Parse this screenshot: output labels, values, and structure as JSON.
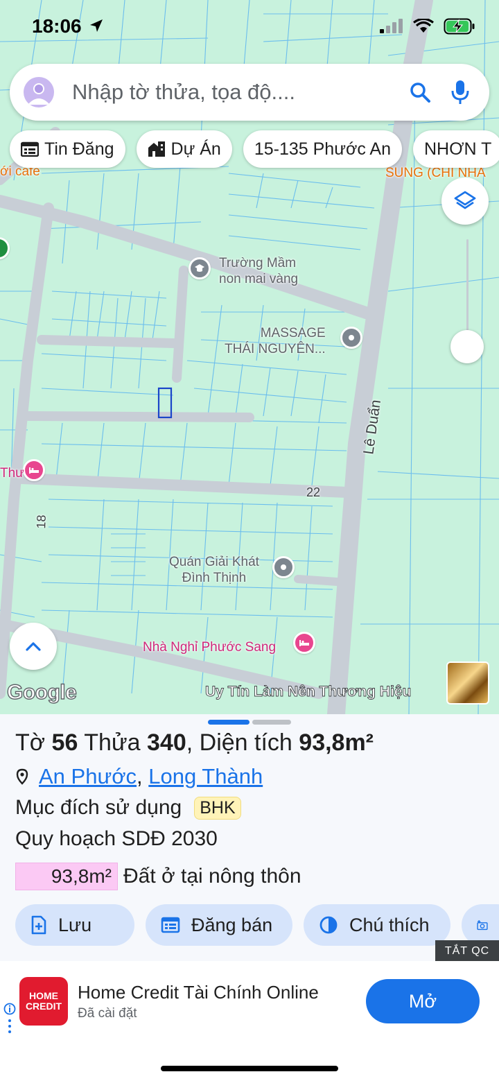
{
  "status_bar": {
    "time": "18:06"
  },
  "search": {
    "placeholder": "Nhập tờ thửa, tọa độ...."
  },
  "chips": [
    "Tin Đăng",
    "Dự Án",
    "15-135 Phước An",
    "NHƠN T"
  ],
  "map": {
    "poi_labels": {
      "school": "Trường Mầm\nnon mai vàng",
      "massage": "MASSAGE\nTHÁI NGUYÊN...",
      "cafe_drink": "Quán Giải Khát\nĐình Thịnh",
      "guesthouse": "Nhà Nghỉ Phước Sang",
      "cafe_partial": "ới cafe",
      "samsung_partial": "SUNG (CHI NHÁ",
      "hotel_partial": "Thư"
    },
    "road_labels": {
      "le_duan": "Lê Duẩn",
      "r22": "22",
      "r18": "18"
    },
    "google_logo": "Google",
    "watermark": "Uy Tín Làm Nên Thương Hiệu"
  },
  "parcel": {
    "sheet_label": "Tờ",
    "sheet_no": "56",
    "plot_label": "Thửa",
    "plot_no": "340",
    "area_label": ", Diện tích",
    "area": "93,8m²",
    "ward": "An Phước",
    "district": "Long Thành",
    "purpose_label": "Mục đích sử dụng",
    "purpose_code": "BHK",
    "planning": "Quy hoạch SDĐ 2030",
    "land_use_area": "93,8m²",
    "land_use_type": "Đất ở tại nông thôn",
    "land_use_color": "#fbc9f4"
  },
  "actions": {
    "save": "Lưu",
    "post": "Đăng bán",
    "legend": "Chú thích"
  },
  "hide_ads": "TẮT QC",
  "ad": {
    "logo_line1": "HOME",
    "logo_line2": "CREDIT",
    "title": "Home Credit Tài Chính Online",
    "subtitle": "Đã cài đặt",
    "open_label": "Mở"
  },
  "colors": {
    "accent": "#1a73e8",
    "map_bg": "#c8f2dd",
    "ad_brand": "#e11b2f"
  }
}
